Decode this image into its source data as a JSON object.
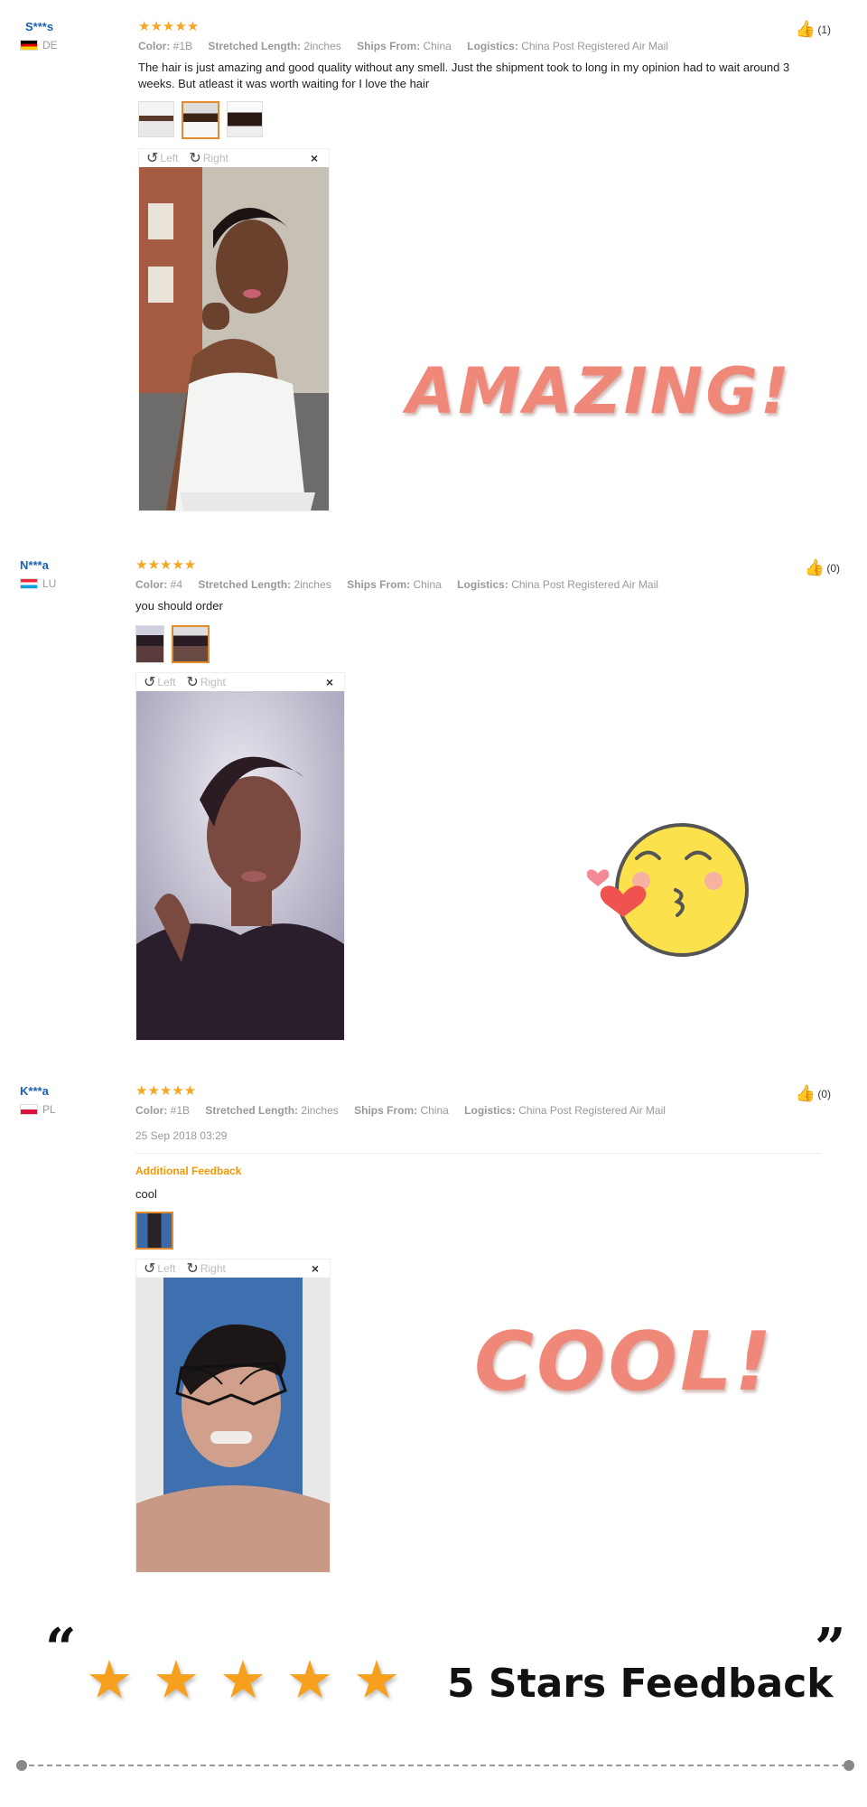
{
  "labels": {
    "color": "Color:",
    "stretched": "Stretched Length:",
    "ships": "Ships From:",
    "logistics": "Logistics:",
    "viewer_left": "Left",
    "viewer_right": "Right",
    "close": "×"
  },
  "reviews": [
    {
      "user": "S***s",
      "country": "DE",
      "stars": "★★★★★",
      "color": "#1B",
      "length": "2inches",
      "ships": "China",
      "logistics": "China Post Registered Air Mail",
      "text": "The hair is just amazing and good quality without any smell. Just the shipment took to long in my opinion had to wait around 3 weeks. But atleast it was worth waiting for I love the hair",
      "likes": "(1)"
    },
    {
      "user": "N***a",
      "country": "LU",
      "stars": "★★★★★",
      "color": "#4",
      "length": "2inches",
      "ships": "China",
      "logistics": "China Post Registered Air Mail",
      "text": "you should order",
      "likes": "(0)"
    },
    {
      "user": "K***a",
      "country": "PL",
      "stars": "★★★★★",
      "color": "#1B",
      "length": "2inches",
      "ships": "China",
      "logistics": "China Post Registered Air Mail",
      "date": "25 Sep 2018 03:29",
      "additional_label": "Additional Feedback",
      "text": "cool",
      "likes": "(0)"
    }
  ],
  "overlays": {
    "amazing": "AMAZING!",
    "cool": "COOL!"
  },
  "banner": {
    "open_quote": "“",
    "close_quote": "”",
    "star": "★",
    "title": "5 Stars Feedback"
  },
  "colors": {
    "accent_orange": "#f39800",
    "overlay_pink": "#f0887a",
    "user_blue": "#1a5fb4"
  }
}
